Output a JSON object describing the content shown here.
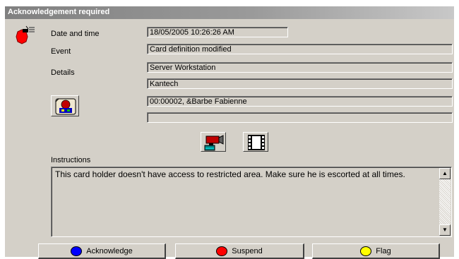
{
  "window": {
    "title": "Acknowledgement required"
  },
  "labels": {
    "date_time": "Date and time",
    "event": "Event",
    "details": "Details",
    "instructions": "Instructions"
  },
  "fields": {
    "date_time": "18/05/2005 10:26:26 AM",
    "event": "Card definition modified",
    "details_1": "Server Workstation",
    "details_2": "Kantech",
    "card_holder": "00:00002, &Barbe Fabienne",
    "extra": ""
  },
  "instructions_text": "This card holder doesn't have access to restricted area. Make sure he is escorted at all times.",
  "buttons": {
    "acknowledge": {
      "label": "Acknowledge",
      "color": "#0000ff"
    },
    "suspend": {
      "label": "Suspend",
      "color": "#ff0000"
    },
    "flag": {
      "label": "Flag",
      "color": "#ffff00"
    }
  },
  "icons": {
    "alarm": "alarm-bell-icon",
    "card_holder": "card-holder-photo-icon",
    "camera": "video-camera-icon",
    "film": "film-playback-icon"
  }
}
